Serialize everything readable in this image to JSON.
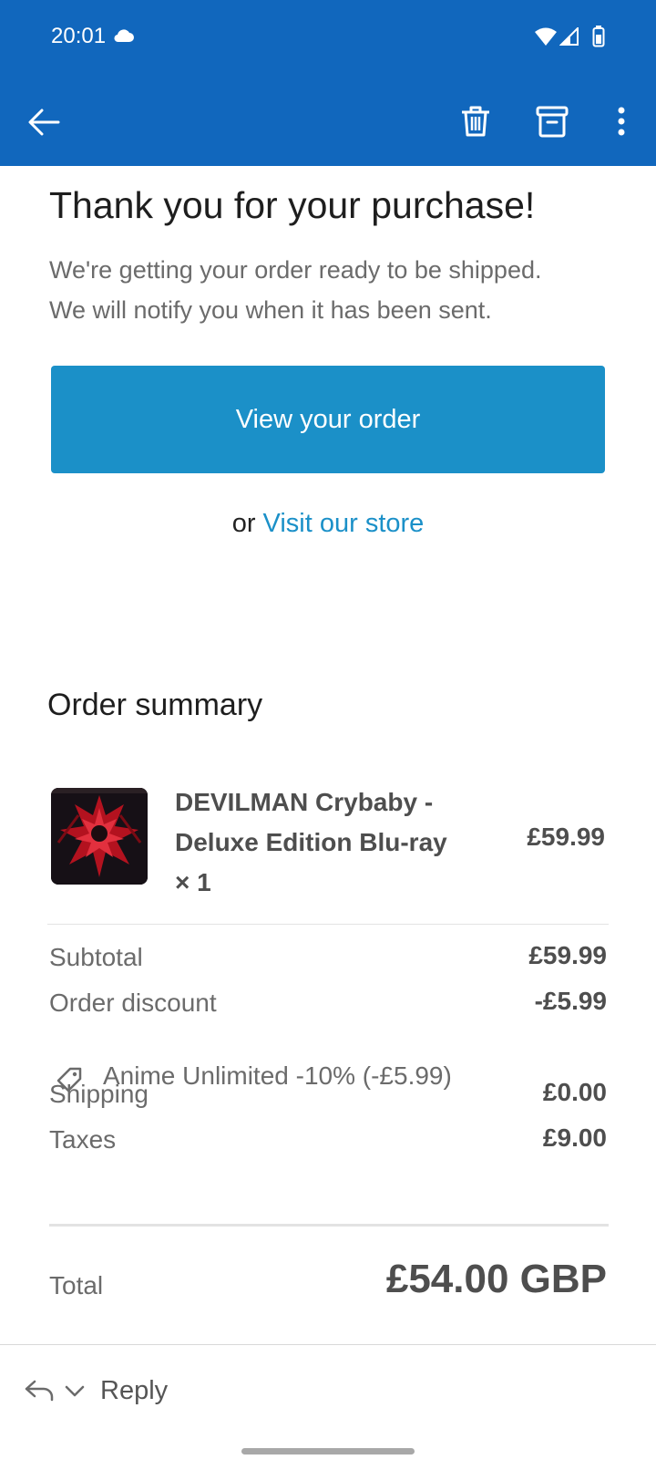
{
  "status_bar": {
    "time": "20:01"
  },
  "toolbar": {
    "back_icon": "arrow-left-icon",
    "delete_icon": "trash-icon",
    "archive_icon": "archive-icon",
    "more_icon": "more-vertical-icon"
  },
  "email": {
    "heading": "Thank you for your purchase!",
    "message_line1": "We're getting your order ready to be shipped.",
    "message_line2": "We will notify you when it has been sent.",
    "view_order_button": "View your order",
    "or_text": "or ",
    "visit_store_link": "Visit our store",
    "accent_color": "#1b90c8"
  },
  "order_summary": {
    "title": "Order summary",
    "product": {
      "name": "DEVILMAN Crybaby - Deluxe Edition Blu-ray × 1",
      "price": "£59.99"
    },
    "subtotal_label": "Subtotal",
    "subtotal_value": "£59.99",
    "discount_label": "Order discount",
    "discount_value": "-£5.99",
    "discount_code": "Anime Unlimited -10% (-£5.99)",
    "shipping_label": "Shipping",
    "shipping_value": "£0.00",
    "taxes_label": "Taxes",
    "taxes_value": "£9.00",
    "total_label": "Total",
    "total_value": "£54.00 GBP"
  },
  "reply_bar": {
    "reply_label": "Reply"
  },
  "colors": {
    "app_bar": "#1167bd",
    "button": "#1b90c8"
  }
}
